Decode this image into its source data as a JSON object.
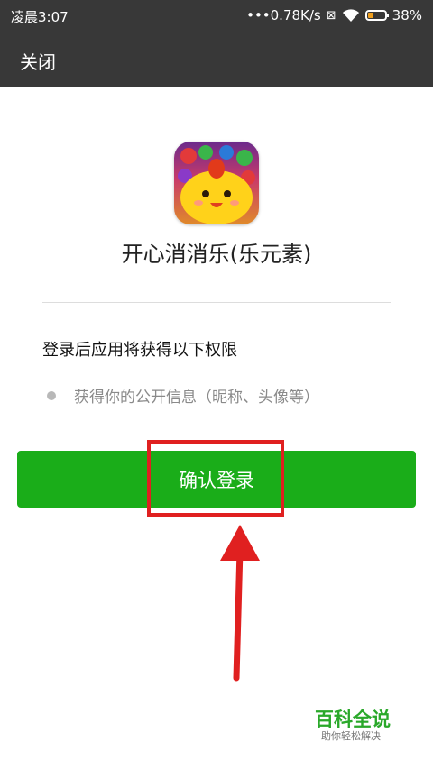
{
  "status_bar": {
    "time": "凌晨3:07",
    "network_speed": "•••0.78K/s",
    "battery_percent": "38%",
    "battery_level": 0.38
  },
  "titlebar": {
    "close_label": "关闭"
  },
  "app": {
    "name": "开心消消乐(乐元素)",
    "icon": "app-icon-cartoon-chick"
  },
  "permissions": {
    "title": "登录后应用将获得以下权限",
    "items": [
      "获得你的公开信息（昵称、头像等）"
    ]
  },
  "actions": {
    "confirm_label": "确认登录"
  },
  "annotations": {
    "highlight_color": "#e02020"
  },
  "watermark": {
    "title": "百科全说",
    "subtitle": "助你轻松解决"
  },
  "colors": {
    "header_bg": "#383838",
    "confirm_bg": "#1aad19"
  }
}
